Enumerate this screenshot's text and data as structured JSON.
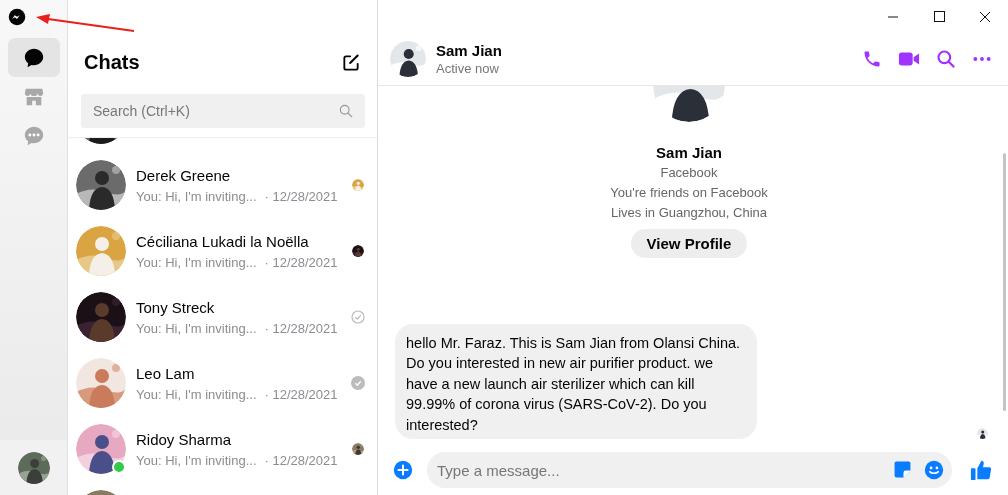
{
  "rail": {
    "items": [
      {
        "kind": "chats",
        "selected": true
      },
      {
        "kind": "marketplace",
        "selected": false
      },
      {
        "kind": "requests",
        "selected": false
      }
    ]
  },
  "chat_list": {
    "title": "Chats",
    "search": {
      "placeholder": "Search (Ctrl+K)"
    },
    "rows": [
      {
        "kind": "partial"
      },
      {
        "kind": "chat",
        "name": "Derek Greene",
        "preview": "You: Hi, I'm inviting...",
        "time": "· 12/28/2021",
        "seen": true,
        "online": false
      },
      {
        "kind": "chat",
        "name": "Céciliana Lukadi la Noëlla",
        "preview": "You: Hi, I'm inviting...",
        "time": "· 12/28/2021",
        "seen": true,
        "online": false
      },
      {
        "kind": "chat",
        "name": "Tony Streck",
        "preview": "You: Hi, I'm inviting...",
        "time": "· 12/28/2021",
        "seen": false,
        "delivered": false,
        "online": false
      },
      {
        "kind": "chat",
        "name": "Leo Lam",
        "preview": "You: Hi, I'm inviting...",
        "time": "· 12/28/2021",
        "seen": false,
        "delivered": true,
        "online": false
      },
      {
        "kind": "chat",
        "name": "Ridoy Sharma",
        "preview": "You: Hi, I'm inviting...",
        "time": "· 12/28/2021",
        "seen": true,
        "online": true
      },
      {
        "kind": "partial"
      }
    ]
  },
  "conversation": {
    "contact": {
      "name": "Sam Jian",
      "status": "Active now"
    },
    "profile": {
      "name": "Sam Jian",
      "lines": [
        "Facebook",
        "You're friends on Facebook",
        "Lives in Guangzhou, China"
      ],
      "button": "View Profile"
    },
    "messages": [
      {
        "text": "hello Mr. Faraz. This is Sam Jian from Olansi China. Do you interested in new air purifier product. we have a new launch air sterilizer which can kill 99.99% of corona virus (SARS-CoV-2). Do you interested?",
        "seen": true
      }
    ],
    "composer": {
      "placeholder": "Type a message..."
    }
  }
}
